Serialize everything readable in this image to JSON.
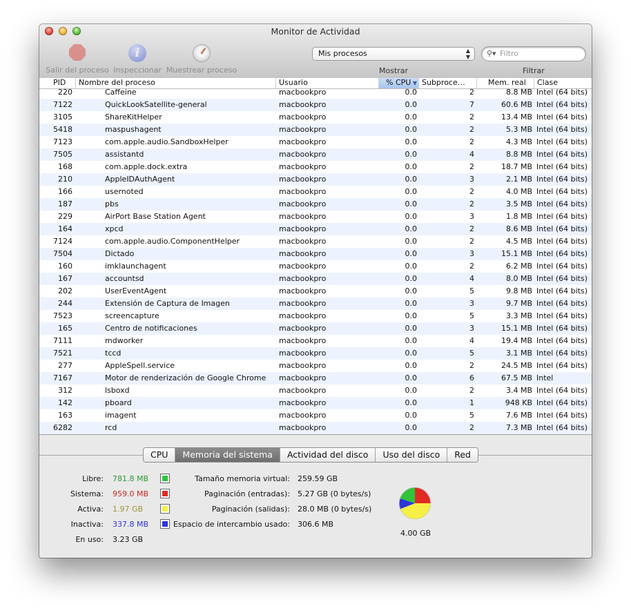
{
  "window": {
    "title": "Monitor de Actividad"
  },
  "toolbar": {
    "quit_label": "Salir del proceso",
    "inspect_label": "Inspeccionar",
    "sample_label": "Muestrear proceso",
    "show_select": "Mis procesos",
    "show_label": "Mostrar",
    "filter_placeholder": "Filtro",
    "filter_label": "Filtrar"
  },
  "table": {
    "columns": {
      "pid": "PID",
      "name": "Nombre del proceso",
      "user": "Usuario",
      "cpu": "% CPU",
      "threads": "Subproce…",
      "mem": "Mem. real",
      "class": "Clase"
    },
    "rows": [
      {
        "pid": "220",
        "name": "Caffeine",
        "user": "macbookpro",
        "cpu": "0.0",
        "threads": "2",
        "mem": "8.8 MB",
        "class": "Intel (64 bits)"
      },
      {
        "pid": "7122",
        "name": "QuickLookSatellite-general",
        "user": "macbookpro",
        "cpu": "0.0",
        "threads": "7",
        "mem": "60.6 MB",
        "class": "Intel (64 bits)"
      },
      {
        "pid": "3105",
        "name": "ShareKitHelper",
        "user": "macbookpro",
        "cpu": "0.0",
        "threads": "2",
        "mem": "13.4 MB",
        "class": "Intel (64 bits)"
      },
      {
        "pid": "5418",
        "name": "maspushagent",
        "user": "macbookpro",
        "cpu": "0.0",
        "threads": "2",
        "mem": "5.3 MB",
        "class": "Intel (64 bits)"
      },
      {
        "pid": "7123",
        "name": "com.apple.audio.SandboxHelper",
        "user": "macbookpro",
        "cpu": "0.0",
        "threads": "2",
        "mem": "4.3 MB",
        "class": "Intel (64 bits)"
      },
      {
        "pid": "7505",
        "name": "assistantd",
        "user": "macbookpro",
        "cpu": "0.0",
        "threads": "4",
        "mem": "8.8 MB",
        "class": "Intel (64 bits)"
      },
      {
        "pid": "168",
        "name": "com.apple.dock.extra",
        "user": "macbookpro",
        "cpu": "0.0",
        "threads": "2",
        "mem": "18.7 MB",
        "class": "Intel (64 bits)"
      },
      {
        "pid": "210",
        "name": "AppleIDAuthAgent",
        "user": "macbookpro",
        "cpu": "0.0",
        "threads": "3",
        "mem": "2.1 MB",
        "class": "Intel (64 bits)"
      },
      {
        "pid": "166",
        "name": "usernoted",
        "user": "macbookpro",
        "cpu": "0.0",
        "threads": "2",
        "mem": "4.0 MB",
        "class": "Intel (64 bits)"
      },
      {
        "pid": "187",
        "name": "pbs",
        "user": "macbookpro",
        "cpu": "0.0",
        "threads": "2",
        "mem": "3.5 MB",
        "class": "Intel (64 bits)"
      },
      {
        "pid": "229",
        "name": "AirPort Base Station Agent",
        "user": "macbookpro",
        "cpu": "0.0",
        "threads": "3",
        "mem": "1.8 MB",
        "class": "Intel (64 bits)"
      },
      {
        "pid": "164",
        "name": "xpcd",
        "user": "macbookpro",
        "cpu": "0.0",
        "threads": "2",
        "mem": "8.6 MB",
        "class": "Intel (64 bits)"
      },
      {
        "pid": "7124",
        "name": "com.apple.audio.ComponentHelper",
        "user": "macbookpro",
        "cpu": "0.0",
        "threads": "2",
        "mem": "4.5 MB",
        "class": "Intel (64 bits)"
      },
      {
        "pid": "7504",
        "name": "Dictado",
        "user": "macbookpro",
        "cpu": "0.0",
        "threads": "3",
        "mem": "15.1 MB",
        "class": "Intel (64 bits)"
      },
      {
        "pid": "160",
        "name": "imklaunchagent",
        "user": "macbookpro",
        "cpu": "0.0",
        "threads": "2",
        "mem": "6.2 MB",
        "class": "Intel (64 bits)"
      },
      {
        "pid": "167",
        "name": "accountsd",
        "user": "macbookpro",
        "cpu": "0.0",
        "threads": "4",
        "mem": "8.0 MB",
        "class": "Intel (64 bits)"
      },
      {
        "pid": "202",
        "name": "UserEventAgent",
        "user": "macbookpro",
        "cpu": "0.0",
        "threads": "5",
        "mem": "9.8 MB",
        "class": "Intel (64 bits)"
      },
      {
        "pid": "244",
        "name": "Extensión de Captura de Imagen",
        "user": "macbookpro",
        "cpu": "0.0",
        "threads": "3",
        "mem": "9.7 MB",
        "class": "Intel (64 bits)"
      },
      {
        "pid": "7523",
        "name": "screencapture",
        "user": "macbookpro",
        "cpu": "0.0",
        "threads": "5",
        "mem": "3.3 MB",
        "class": "Intel (64 bits)"
      },
      {
        "pid": "165",
        "name": "Centro de notificaciones",
        "user": "macbookpro",
        "cpu": "0.0",
        "threads": "3",
        "mem": "15.1 MB",
        "class": "Intel (64 bits)"
      },
      {
        "pid": "7111",
        "name": "mdworker",
        "user": "macbookpro",
        "cpu": "0.0",
        "threads": "4",
        "mem": "19.4 MB",
        "class": "Intel (64 bits)"
      },
      {
        "pid": "7521",
        "name": "tccd",
        "user": "macbookpro",
        "cpu": "0.0",
        "threads": "5",
        "mem": "3.1 MB",
        "class": "Intel (64 bits)"
      },
      {
        "pid": "277",
        "name": "AppleSpell.service",
        "user": "macbookpro",
        "cpu": "0.0",
        "threads": "2",
        "mem": "24.5 MB",
        "class": "Intel (64 bits)"
      },
      {
        "pid": "7167",
        "name": "Motor de renderización de Google Chrome",
        "user": "macbookpro",
        "cpu": "0.0",
        "threads": "6",
        "mem": "67.5 MB",
        "class": "Intel"
      },
      {
        "pid": "312",
        "name": "lsboxd",
        "user": "macbookpro",
        "cpu": "0.0",
        "threads": "2",
        "mem": "3.4 MB",
        "class": "Intel (64 bits)"
      },
      {
        "pid": "142",
        "name": "pboard",
        "user": "macbookpro",
        "cpu": "0.0",
        "threads": "1",
        "mem": "948 KB",
        "class": "Intel (64 bits)"
      },
      {
        "pid": "163",
        "name": "imagent",
        "user": "macbookpro",
        "cpu": "0.0",
        "threads": "5",
        "mem": "7.6 MB",
        "class": "Intel (64 bits)"
      },
      {
        "pid": "6282",
        "name": "rcd",
        "user": "macbookpro",
        "cpu": "0.0",
        "threads": "2",
        "mem": "7.3 MB",
        "class": "Intel (64 bits)"
      }
    ]
  },
  "tabs": [
    "CPU",
    "Memoria del sistema",
    "Actividad del disco",
    "Uso del disco",
    "Red"
  ],
  "memory": {
    "free_label": "Libre:",
    "free_value": "781.8 MB",
    "free_color": "#2fc43a",
    "wired_label": "Sistema:",
    "wired_value": "959.0 MB",
    "wired_color": "#e02a22",
    "active_label": "Activa:",
    "active_value": "1.97 GB",
    "active_color": "#f6ef45",
    "inactive_label": "Inactiva:",
    "inactive_value": "337.8 MB",
    "inactive_color": "#2c35d8",
    "used_label": "En uso:",
    "used_value": "3.23 GB",
    "vm_size_label": "Tamaño memoria virtual:",
    "vm_size_value": "259.59 GB",
    "page_ins_label": "Paginación (entradas):",
    "page_ins_value": "5.27 GB (0 bytes/s)",
    "page_outs_label": "Paginación (salidas):",
    "page_outs_value": "28.0 MB (0 bytes/s)",
    "swap_label": "Espacio de intercambio usado:",
    "swap_value": "306.6 MB",
    "total": "4.00 GB"
  }
}
